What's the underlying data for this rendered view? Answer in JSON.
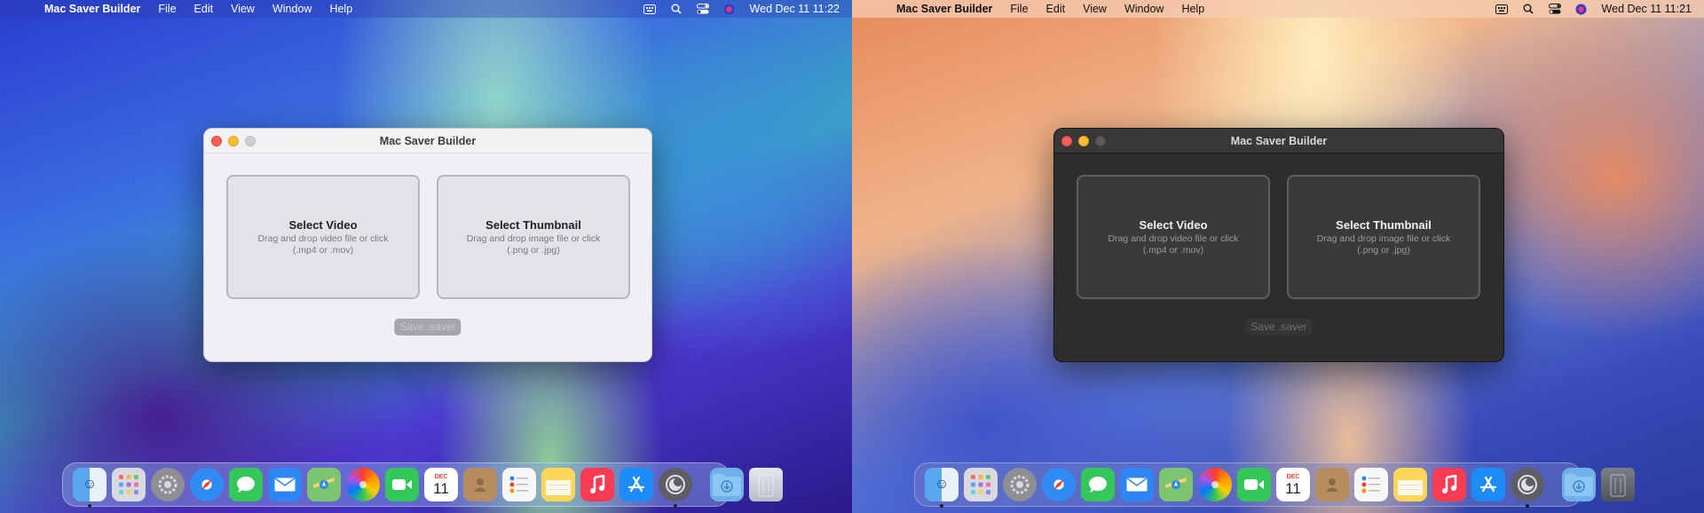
{
  "menubar": {
    "apple_icon": "",
    "app_name": "Mac Saver Builder",
    "menus": [
      "File",
      "Edit",
      "View",
      "Window",
      "Help"
    ],
    "status_icons": [
      "keyboard-layout-icon",
      "search-icon",
      "control-center-icon",
      "siri-icon"
    ]
  },
  "screens": {
    "light": {
      "clock": "Wed Dec 11  11:22"
    },
    "dark": {
      "clock": "Wed Dec 11  11:21"
    }
  },
  "window": {
    "title": "Mac Saver Builder",
    "video_zone": {
      "title": "Select Video",
      "desc_line1": "Drag and drop video file or click",
      "desc_line2": "(.mp4 or .mov)"
    },
    "thumb_zone": {
      "title": "Select Thumbnail",
      "desc_line1": "Drag and drop image file or click",
      "desc_line2": "(.png or .jpg)"
    },
    "save_label": "Save .saver"
  },
  "dock": {
    "calendar_month": "DEC",
    "calendar_day": "11",
    "apps": [
      "Finder",
      "Launchpad",
      "System Settings",
      "Safari",
      "Messages",
      "Mail",
      "Maps",
      "Photos",
      "FaceTime",
      "Calendar",
      "Contacts",
      "Reminders",
      "Notes",
      "Music",
      "App Store",
      "Mac Saver Builder",
      "Downloads",
      "Trash"
    ]
  },
  "colors": {
    "close": "#ff5f57",
    "minimize": "#febc2e",
    "light_window_bg": "#ececec",
    "dark_window_bg": "#2d2d2d"
  }
}
